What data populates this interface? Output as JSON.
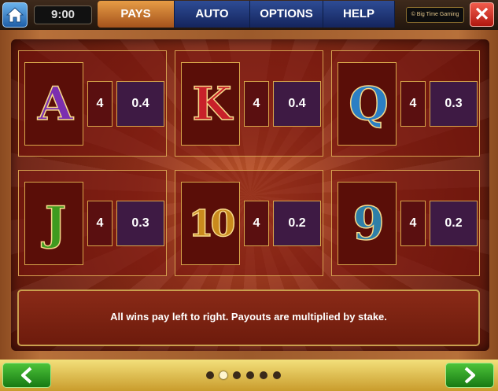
{
  "header": {
    "clock": "9:00",
    "tabs": [
      {
        "label": "PAYS",
        "active": true
      },
      {
        "label": "AUTO",
        "active": false
      },
      {
        "label": "OPTIONS",
        "active": false
      },
      {
        "label": "HELP",
        "active": false
      }
    ],
    "brand": "© Big Time Gaming"
  },
  "paytable": [
    {
      "symbol": "A",
      "count": "4",
      "payout": "0.4",
      "color": "#7b2fb0"
    },
    {
      "symbol": "K",
      "count": "4",
      "payout": "0.4",
      "color": "#c8202a"
    },
    {
      "symbol": "Q",
      "count": "4",
      "payout": "0.3",
      "color": "#2b7fc4"
    },
    {
      "symbol": "J",
      "count": "4",
      "payout": "0.3",
      "color": "#3f9b1f"
    },
    {
      "symbol": "10",
      "count": "4",
      "payout": "0.2",
      "color": "#c98a1c"
    },
    {
      "symbol": "9",
      "count": "4",
      "payout": "0.2",
      "color": "#2e7fa8"
    }
  ],
  "info_text": "All wins pay left to right. Payouts are multiplied by stake.",
  "pagination": {
    "total": 6,
    "current": 2
  }
}
